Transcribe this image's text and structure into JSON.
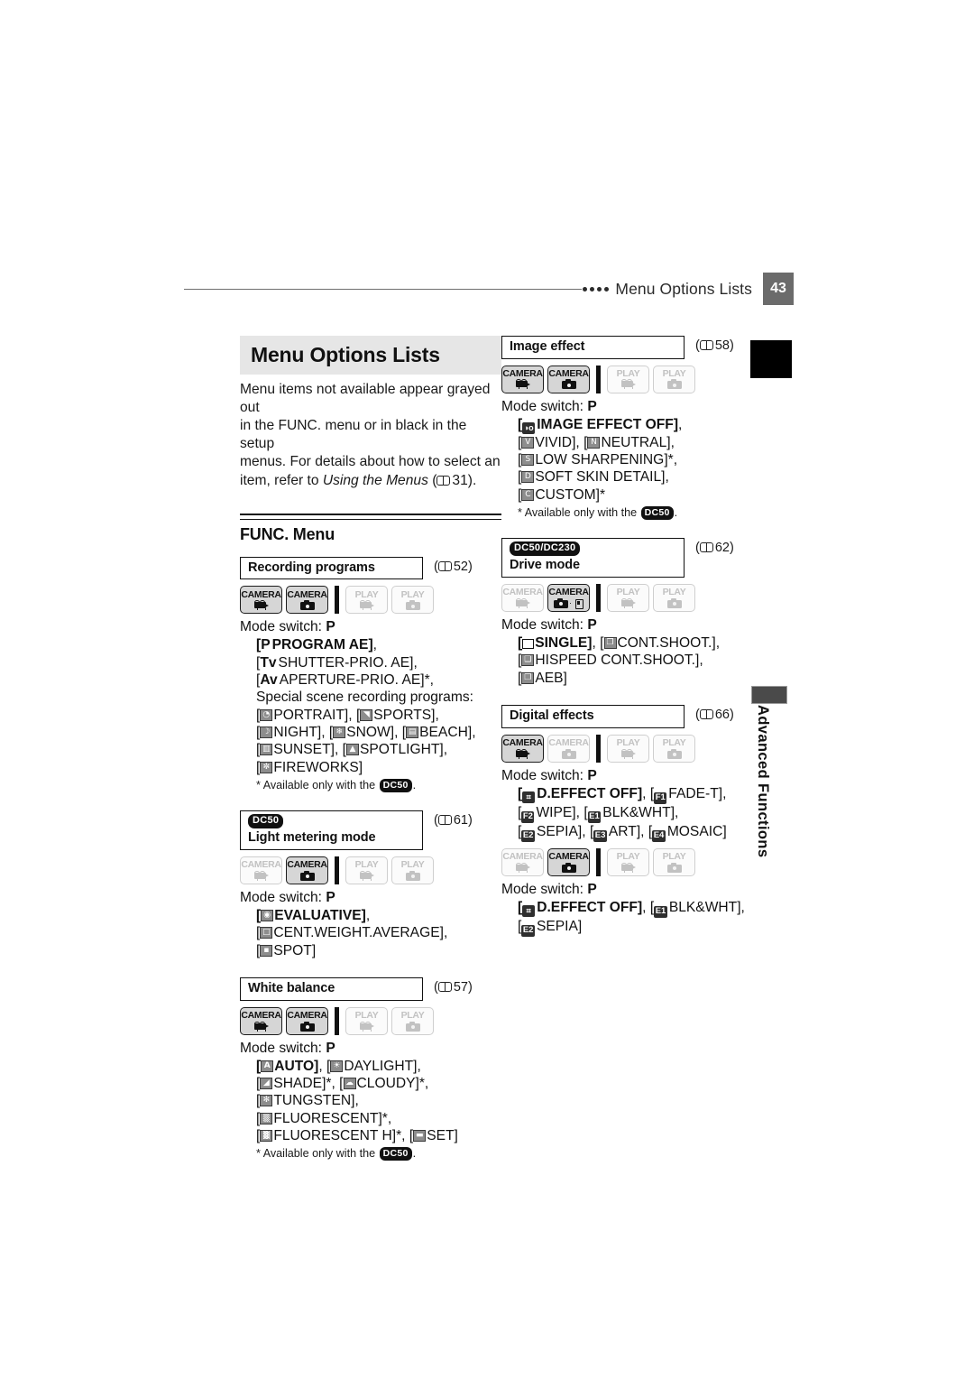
{
  "header": {
    "title": "Menu Options Lists",
    "page_number": "43",
    "dots": 4
  },
  "side_tab": {
    "label": "Advanced Functions"
  },
  "chapter": {
    "title": "Menu Options Lists",
    "intro_lines": [
      "Menu items not available appear grayed out",
      "in the FUNC. menu or in black in the setup",
      "menus. For details about how to select an"
    ],
    "intro_last_prefix": "item, refer to ",
    "intro_italic": "Using the Menus",
    "intro_pageref": "31"
  },
  "subsection": {
    "label": "FUNC. Menu"
  },
  "mode_button_labels": {
    "camera": "CAMERA",
    "play": "PLAY"
  },
  "footnote_text": {
    "prefix": "* Available only with the",
    "badge": "DC50",
    "suffix": "."
  },
  "mode_switch_label": "Mode switch:",
  "mode_switch_value": "P",
  "left_column": [
    {
      "name": "Recording programs",
      "badge": null,
      "pageref": "52",
      "modes": [
        "camera-video-on",
        "camera-still-on",
        "play-video-off",
        "play-still-off"
      ],
      "options": [
        [
          {
            "tag": "P",
            "text": "PROGRAM AE",
            "bold": true,
            "bracket": true,
            "trail": ","
          }
        ],
        [
          {
            "tag": "Tv",
            "text": "SHUTTER-PRIO. AE",
            "bracket": true,
            "trail": ","
          }
        ],
        [
          {
            "tag": "Av",
            "text": "APERTURE-PRIO. AE",
            "bracket": true,
            "trail": "*,"
          }
        ],
        [
          {
            "plain": "Special scene recording programs:"
          }
        ],
        [
          {
            "icon": "portrait",
            "text": "PORTRAIT",
            "bracket": true,
            "trail": ","
          },
          {
            "icon": "sports",
            "text": "SPORTS",
            "bracket": true,
            "trail": ","
          }
        ],
        [
          {
            "icon": "night",
            "text": "NIGHT",
            "bracket": true,
            "trail": ","
          },
          {
            "icon": "snow",
            "text": "SNOW",
            "bracket": true,
            "trail": ","
          },
          {
            "icon": "beach",
            "text": "BEACH",
            "bracket": true,
            "trail": ","
          }
        ],
        [
          {
            "icon": "sunset",
            "text": "SUNSET",
            "bracket": true,
            "trail": ","
          },
          {
            "icon": "spotlight",
            "text": "SPOTLIGHT",
            "bracket": true,
            "trail": ","
          }
        ],
        [
          {
            "icon": "fireworks",
            "text": "FIREWORKS",
            "bracket": true
          }
        ]
      ],
      "footnote": true
    },
    {
      "name": "Light metering mode",
      "badge": "DC50",
      "pageref": "61",
      "modes": [
        "camera-video-off",
        "camera-still-on",
        "play-video-off",
        "play-still-off"
      ],
      "options": [
        [
          {
            "icon": "evaluative",
            "text": "EVALUATIVE",
            "bold": true,
            "bracket": true,
            "trail": ","
          }
        ],
        [
          {
            "icon": "centweight",
            "text": "CENT.WEIGHT.AVERAGE",
            "bracket": true,
            "trail": ","
          }
        ],
        [
          {
            "icon": "spot",
            "text": "SPOT",
            "bracket": true
          }
        ]
      ],
      "footnote": false
    },
    {
      "name": "White balance",
      "badge": null,
      "pageref": "57",
      "modes": [
        "camera-video-on",
        "camera-still-on",
        "play-video-off",
        "play-still-off"
      ],
      "options": [
        [
          {
            "icon": "auto",
            "text": "AUTO",
            "bold": true,
            "bracket": true,
            "trail": ","
          },
          {
            "icon": "daylight",
            "text": "DAYLIGHT",
            "bracket": true,
            "trail": ","
          }
        ],
        [
          {
            "icon": "shade",
            "text": "SHADE",
            "bracket": true,
            "trail": "*,"
          },
          {
            "icon": "cloudy",
            "text": "CLOUDY",
            "bracket": true,
            "trail": "*,"
          }
        ],
        [
          {
            "icon": "tungsten",
            "text": "TUNGSTEN",
            "bracket": true,
            "trail": ","
          }
        ],
        [
          {
            "icon": "fluorescent",
            "text": "FLUORESCENT",
            "bracket": true,
            "trail": "*,"
          }
        ],
        [
          {
            "icon": "fluorescenth",
            "text": "FLUORESCENT H",
            "bracket": true,
            "trail": "*,"
          },
          {
            "icon": "set",
            "text": "SET",
            "bracket": true
          }
        ]
      ],
      "footnote": true
    }
  ],
  "right_column": [
    {
      "name": "Image effect",
      "badge": null,
      "pageref": "58",
      "modes": [
        "camera-video-on",
        "camera-still-on",
        "play-video-off",
        "play-still-off"
      ],
      "options": [
        [
          {
            "icon": "effectoff",
            "text": "IMAGE EFFECT OFF",
            "bold": true,
            "bracket": true,
            "trail": ","
          }
        ],
        [
          {
            "icon": "vivid",
            "text": "VIVID",
            "bracket": true,
            "trail": ","
          },
          {
            "icon": "neutral",
            "text": "NEUTRAL",
            "bracket": true,
            "trail": ","
          }
        ],
        [
          {
            "icon": "lowsharp",
            "text": "LOW SHARPENING",
            "bracket": true,
            "trail": "*,"
          }
        ],
        [
          {
            "icon": "softskin",
            "text": "SOFT SKIN DETAIL",
            "bracket": true,
            "trail": ","
          }
        ],
        [
          {
            "icon": "custom",
            "text": "CUSTOM",
            "bracket": true,
            "trail": "*"
          }
        ]
      ],
      "footnote": true
    },
    {
      "name": "Drive mode",
      "badge": "DC50/DC230",
      "pageref": "62",
      "modes": [
        "camera-video-off",
        "camera-card-on",
        "play-video-off",
        "play-still-off"
      ],
      "options": [
        [
          {
            "icon": "single",
            "text": "SINGLE",
            "bold": true,
            "bracket": true,
            "trail": ","
          },
          {
            "icon": "contshoot",
            "text": "CONT.SHOOT.",
            "bracket": true,
            "trail": ","
          }
        ],
        [
          {
            "icon": "hispeed",
            "text": "HISPEED CONT.SHOOT.",
            "bracket": true,
            "trail": ","
          }
        ],
        [
          {
            "icon": "aeb",
            "text": "AEB",
            "bracket": true
          }
        ]
      ],
      "footnote": false
    },
    {
      "name": "Digital effects",
      "badge": null,
      "pageref": "66",
      "modes": [
        "camera-video-on",
        "camera-still-off",
        "play-video-off",
        "play-still-off"
      ],
      "options": [
        [
          {
            "icon": "deffectoff",
            "text": "D.EFFECT OFF",
            "bold": true,
            "bracket": true,
            "trail": ","
          },
          {
            "icon": "f1",
            "text": "FADE-T",
            "bracket": true,
            "trail": ","
          }
        ],
        [
          {
            "icon": "f2",
            "text": "WIPE",
            "bracket": true,
            "trail": ","
          },
          {
            "icon": "e1",
            "text": "BLK&WHT",
            "bracket": true,
            "trail": ","
          }
        ],
        [
          {
            "icon": "e2",
            "text": "SEPIA",
            "bracket": true,
            "trail": ","
          },
          {
            "icon": "e3",
            "text": "ART",
            "bracket": true,
            "trail": ","
          },
          {
            "icon": "e4",
            "text": "MOSAIC",
            "bracket": true
          }
        ]
      ],
      "footnote": false,
      "second_modes": [
        "camera-video-off",
        "camera-still-on",
        "play-video-off",
        "play-still-off"
      ],
      "second_options": [
        [
          {
            "icon": "deffectoff",
            "text": "D.EFFECT OFF",
            "bold": true,
            "bracket": true,
            "trail": ","
          },
          {
            "icon": "e1",
            "text": "BLK&WHT",
            "bracket": true,
            "trail": ","
          }
        ],
        [
          {
            "icon": "e2",
            "text": "SEPIA",
            "bracket": true
          }
        ]
      ]
    }
  ],
  "icon_names": {
    "portrait": "portrait-scene-icon",
    "sports": "sports-scene-icon",
    "night": "night-scene-icon",
    "snow": "snow-scene-icon",
    "beach": "beach-scene-icon",
    "sunset": "sunset-scene-icon",
    "spotlight": "spotlight-scene-icon",
    "fireworks": "fireworks-scene-icon",
    "evaluative": "evaluative-metering-icon",
    "centweight": "center-weight-metering-icon",
    "spot": "spot-metering-icon",
    "auto": "auto-white-balance-icon",
    "daylight": "daylight-icon",
    "shade": "shade-icon",
    "cloudy": "cloudy-icon",
    "tungsten": "tungsten-icon",
    "fluorescent": "fluorescent-icon",
    "fluorescenth": "fluorescent-h-icon",
    "set": "custom-wb-set-icon",
    "effectoff": "image-effect-off-icon",
    "vivid": "vivid-icon",
    "neutral": "neutral-icon",
    "lowsharp": "low-sharpening-icon",
    "softskin": "soft-skin-detail-icon",
    "custom": "custom-effect-icon",
    "single": "single-drive-icon",
    "contshoot": "continuous-shoot-icon",
    "hispeed": "hispeed-continuous-shoot-icon",
    "aeb": "aeb-icon",
    "deffectoff": "digital-effect-off-icon",
    "f1": "fade-trigger-icon",
    "f2": "wipe-icon",
    "e1": "blk-wht-icon",
    "e2": "sepia-icon",
    "e3": "art-icon",
    "e4": "mosaic-icon"
  },
  "colors": {
    "page_tab": "#6b6b6b",
    "chapter_tab": "#000000",
    "title_band": "#e6e6e6",
    "side_tab": "#4a4a4a"
  }
}
